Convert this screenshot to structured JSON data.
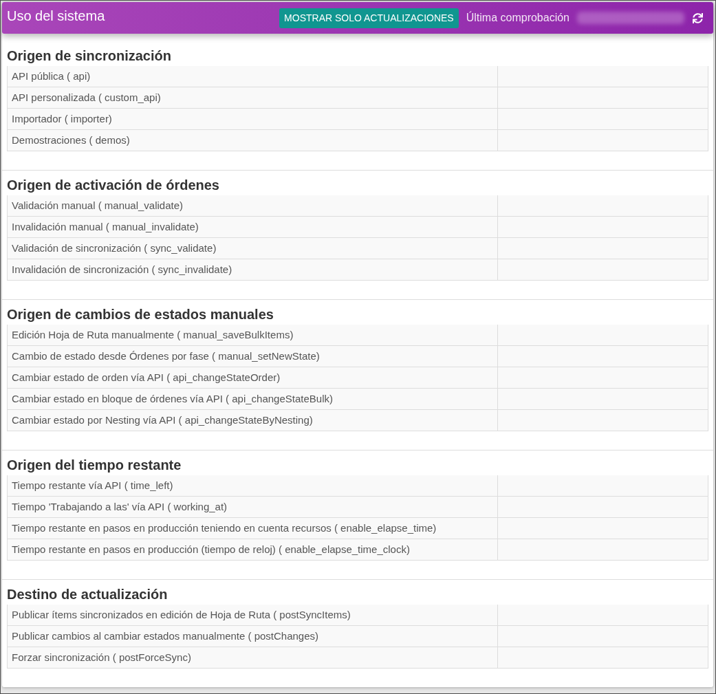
{
  "header": {
    "title": "Uso del sistema",
    "filter_button": "MOSTRAR SOLO ACTUALIZACIONES",
    "last_check_label": "Última comprobación"
  },
  "sections": [
    {
      "title": "Origen de sincronización",
      "rows": [
        {
          "label": "API pública ( api)"
        },
        {
          "label": "API personalizada ( custom_api)"
        },
        {
          "label": "Importador ( importer)"
        },
        {
          "label": "Demostraciones ( demos)"
        }
      ]
    },
    {
      "title": "Origen de activación de órdenes",
      "rows": [
        {
          "label": "Validación manual ( manual_validate)"
        },
        {
          "label": "Invalidación manual ( manual_invalidate)"
        },
        {
          "label": "Validación de sincronización ( sync_validate)"
        },
        {
          "label": "Invalidación de sincronización ( sync_invalidate)"
        }
      ]
    },
    {
      "title": "Origen de cambios de estados manuales",
      "rows": [
        {
          "label": "Edición Hoja de Ruta manualmente ( manual_saveBulkItems)"
        },
        {
          "label": "Cambio de estado desde Órdenes por fase ( manual_setNewState)"
        },
        {
          "label": "Cambiar estado de orden vía API ( api_changeStateOrder)"
        },
        {
          "label": "Cambiar estado en bloque de órdenes vía API ( api_changeStateBulk)"
        },
        {
          "label": "Cambiar estado por Nesting vía API ( api_changeStateByNesting)"
        }
      ]
    },
    {
      "title": "Origen del tiempo restante",
      "rows": [
        {
          "label": "Tiempo restante vía API ( time_left)"
        },
        {
          "label": "Tiempo 'Trabajando a las' vía API ( working_at)"
        },
        {
          "label": "Tiempo restante en pasos en producción teniendo en cuenta recursos ( enable_elapse_time)"
        },
        {
          "label": "Tiempo restante en pasos en producción (tiempo de reloj) ( enable_elapse_time_clock)"
        }
      ]
    },
    {
      "title": "Destino de actualización",
      "rows": [
        {
          "label": "Publicar ítems sincronizados en edición de Hoja de Ruta ( postSyncItems)"
        },
        {
          "label": "Publicar cambios al cambiar estados manualmente ( postChanges)"
        },
        {
          "label": "Forzar sincronización ( postForceSync)"
        }
      ]
    }
  ]
}
